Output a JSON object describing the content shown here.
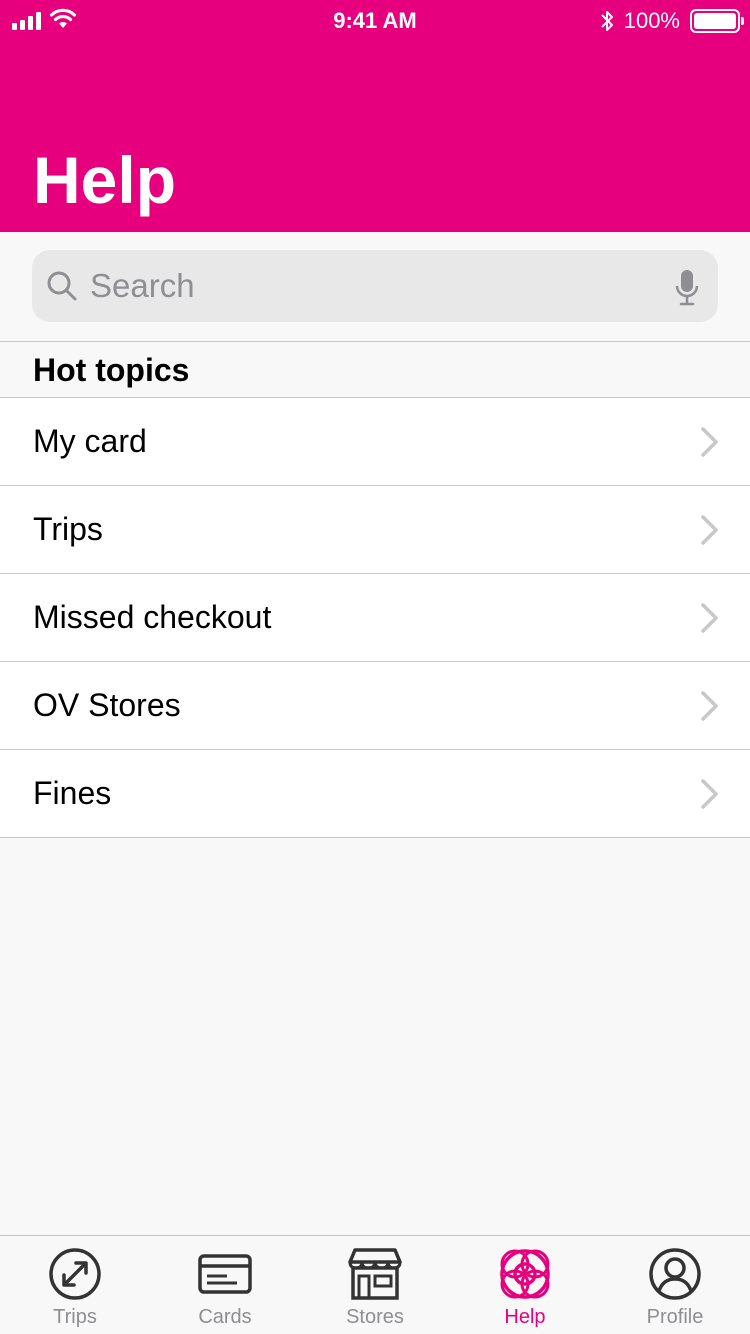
{
  "status_bar": {
    "time": "9:41 AM",
    "battery": "100%",
    "icons": [
      "signal-icon",
      "wifi-icon",
      "bluetooth-icon",
      "battery-icon"
    ]
  },
  "header": {
    "title": "Help",
    "background_color": "#e6007e"
  },
  "search": {
    "placeholder": "Search",
    "value": "",
    "icons": [
      "search-icon",
      "microphone-icon"
    ]
  },
  "section": {
    "title": "Hot topics"
  },
  "topics": [
    {
      "label": "My card"
    },
    {
      "label": "Trips"
    },
    {
      "label": "Missed checkout"
    },
    {
      "label": "OV Stores"
    },
    {
      "label": "Fines"
    }
  ],
  "tabbar": {
    "active": "Help",
    "accent_color": "#e6007e",
    "inactive_color": "#333333",
    "tabs": [
      {
        "label": "Trips",
        "icon": "trips-arrow-icon"
      },
      {
        "label": "Cards",
        "icon": "card-icon"
      },
      {
        "label": "Stores",
        "icon": "store-icon"
      },
      {
        "label": "Help",
        "icon": "lifebuoy-icon"
      },
      {
        "label": "Profile",
        "icon": "profile-icon"
      }
    ]
  }
}
